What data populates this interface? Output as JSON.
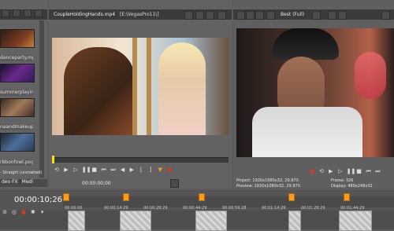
{
  "media_panel": {
    "items": [
      {
        "label": "danceparty.mp4"
      },
      {
        "label": "summerplaying..."
      },
      {
        "label": "naandmakeup.png"
      },
      {
        "label": "rbbonfowl.png"
      }
    ],
    "bottom_tabs": [
      "deo FX",
      "Medi"
    ],
    "transition_item": "- Straight (unmatted)"
  },
  "trimmer": {
    "file_tab": "CoupleHoldingHands.mp4",
    "path": "[E:\\VegasPro11\\]",
    "timecode": "00:00:00;00"
  },
  "preview": {
    "quality": "Best (Full)",
    "project_label": "Project:",
    "project_value": "1920x1080x32, 29.970",
    "preview_label": "Preview:",
    "preview_value": "1920x1080x32, 29.970",
    "frame_label": "Frame:",
    "frame_value": "326",
    "display_label": "Display:",
    "display_value": "480x248x32"
  },
  "timeline": {
    "timecode": "00:00:10;26",
    "ruler_ticks": [
      "00:00:00",
      "00:00:14:29",
      "00:00:29:29",
      "00:00:44:29",
      "00:00:59:28",
      "00:01:14:29",
      "00:01:29:29",
      "00:01:44:29"
    ]
  },
  "colors": {
    "accent_marker": "#ff9a1f",
    "record_red": "#d43a2a"
  }
}
